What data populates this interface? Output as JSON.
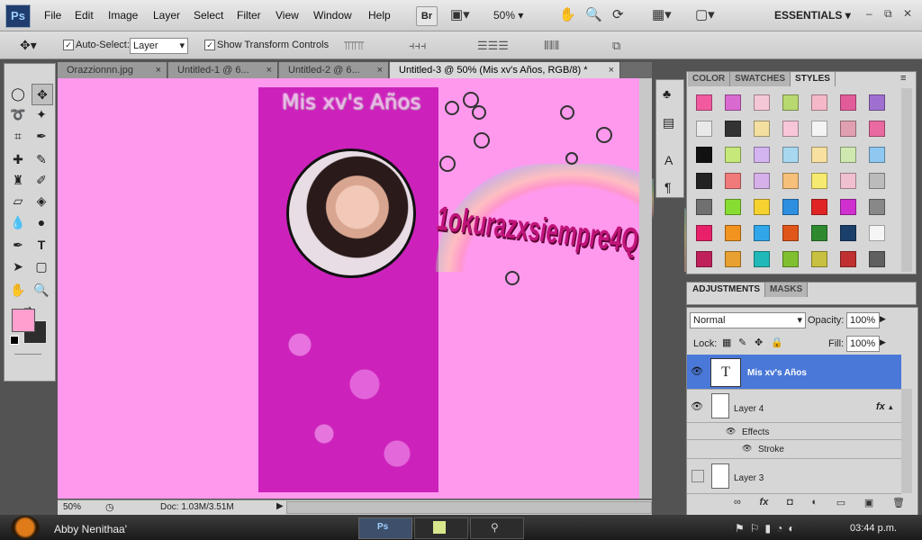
{
  "menubar": {
    "logo": "Ps",
    "items": [
      "File",
      "Edit",
      "Image",
      "Layer",
      "Select",
      "Filter",
      "View",
      "Window",
      "Help"
    ],
    "bridge": "Br",
    "zoom": "50%",
    "workspace": "ESSENTIALS",
    "window_controls": [
      "–",
      "⧉",
      "✕"
    ]
  },
  "options": {
    "auto_select_label": "Auto-Select:",
    "auto_select_value": "Layer",
    "show_transform_label": "Show Transform Controls",
    "checked": "✓"
  },
  "tabs": [
    {
      "label": "Orazzionnn.jpg",
      "close": "×"
    },
    {
      "label": "Untitled-1 @ 6...",
      "close": "×"
    },
    {
      "label": "Untitled-2 @ 6...",
      "close": "×"
    },
    {
      "label": "Untitled-3 @ 50% (Mis xv's Años, RGB/8) *",
      "close": "×"
    }
  ],
  "canvas": {
    "title_text": "Mis xv's Años",
    "watermark_text": "1okurazxsiempre4Q",
    "colors": {
      "background": "#ff99ee",
      "card": "#cc22bb"
    }
  },
  "status": {
    "zoom": "50%",
    "doc": "Doc: 1.03M/3.51M"
  },
  "right_panels": {
    "top_tabs": [
      "COLOR",
      "SWATCHES",
      "STYLES"
    ],
    "adj_tabs": [
      "ADJUSTMENTS",
      "MASKS"
    ],
    "style_colors": [
      "#f25aa0",
      "#d96ad0",
      "#f4c7d7",
      "#b8d870",
      "#f5b8c8",
      "#e35c9a",
      "#a070d0",
      "#e9e9e9",
      "#333333",
      "#f3e0a0",
      "#f7c6d8",
      "#f4f4f4",
      "#e0a0b0",
      "#e86aa0",
      "#111111",
      "#c6e87a",
      "#d3b3f0",
      "#a8d8f0",
      "#f7e0a0",
      "#cfe8b0",
      "#8ec8f0",
      "#222222",
      "#f07a7a",
      "#d6b0e8",
      "#f6c07a",
      "#f7ea70",
      "#f0c0d0",
      "#bbbbbb",
      "#707070",
      "#88dd33",
      "#f5d230",
      "#2e8fe0",
      "#e02424",
      "#d030d0",
      "#888888",
      "#e8206a",
      "#f29320",
      "#31a6e8",
      "#e0561a",
      "#2f8a2f",
      "#1a3f6a",
      "#f5f5f5",
      "#c0205a",
      "#e8a030",
      "#20b8b8",
      "#80c030",
      "#c8c040",
      "#c03030",
      "#606060"
    ]
  },
  "layers": {
    "blend_mode": "Normal",
    "opacity_label": "Opacity:",
    "opacity_value": "100%",
    "lock_label": "Lock:",
    "fill_label": "Fill:",
    "fill_value": "100%",
    "rows": [
      {
        "name": "Mis xv's Años",
        "thumb": "T"
      },
      {
        "name": "Layer 4",
        "fx": "fx"
      },
      {
        "name": "Effects"
      },
      {
        "name": "Stroke"
      },
      {
        "name": "Layer 3"
      }
    ],
    "bottom_icons": [
      "∞",
      "fx",
      "◘",
      "◐",
      "▭",
      "▣",
      "🗑"
    ]
  },
  "taskbar": {
    "user": "Abby Nenithaa'",
    "ps_label": "Ps",
    "clock": "03:44 p.m."
  }
}
